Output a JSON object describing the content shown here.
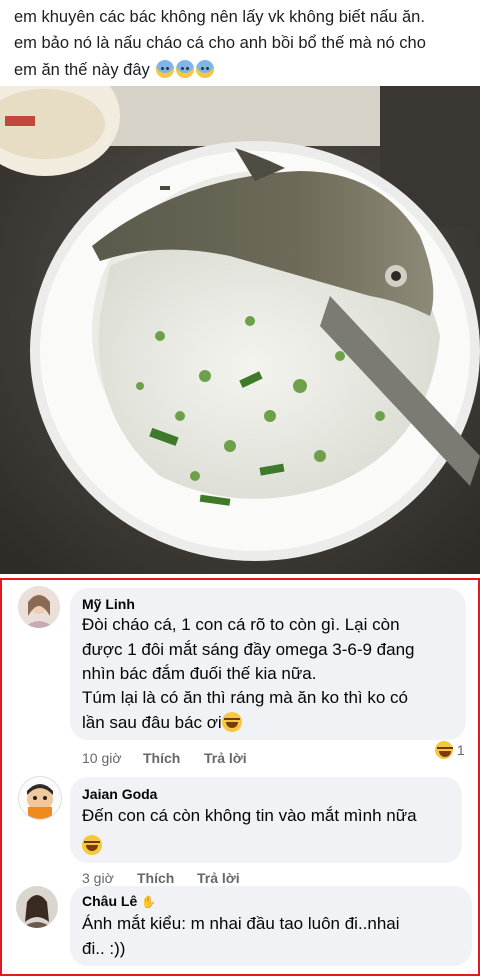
{
  "post": {
    "lines": [
      "em khuyên các bác không nên lấy vk không biết nấu ăn.",
      "em bảo nó là nấu cháo cá cho anh bồi bổ thế mà nó cho",
      "em ăn thế này đây"
    ],
    "emoji_icon": "anxious-face-icon"
  },
  "comments": [
    {
      "name": "Mỹ Linh",
      "lines": [
        "Đòi cháo cá, 1 con cá rõ to còn gì. Lại còn",
        "được 1 đôi mắt sáng đầy omega 3-6-9 đang",
        "nhìn bác đắm đuối thế kia nữa.",
        "Túm lại là có ăn thì ráng mà ăn ko thì ko có",
        "lần sau đâu bác ơi"
      ],
      "time": "10 giờ",
      "like": "Thích",
      "reply": "Trả lời",
      "reaction_count": "1"
    },
    {
      "name": "Jaian Goda",
      "lines": [
        "Đến con cá còn không tin vào mắt mình nữa"
      ],
      "time": "3 giờ",
      "like": "Thích",
      "reply": "Trả lời"
    },
    {
      "name": "Châu Lê",
      "lines": [
        "Ánh mắt kiểu: m nhai đầu tao luôn đi..nhai",
        "đi.. :))"
      ]
    }
  ],
  "colors": {
    "highlight_border": "#e3191f",
    "bubble": "#f0f2f5",
    "meta_text": "#65676b"
  }
}
